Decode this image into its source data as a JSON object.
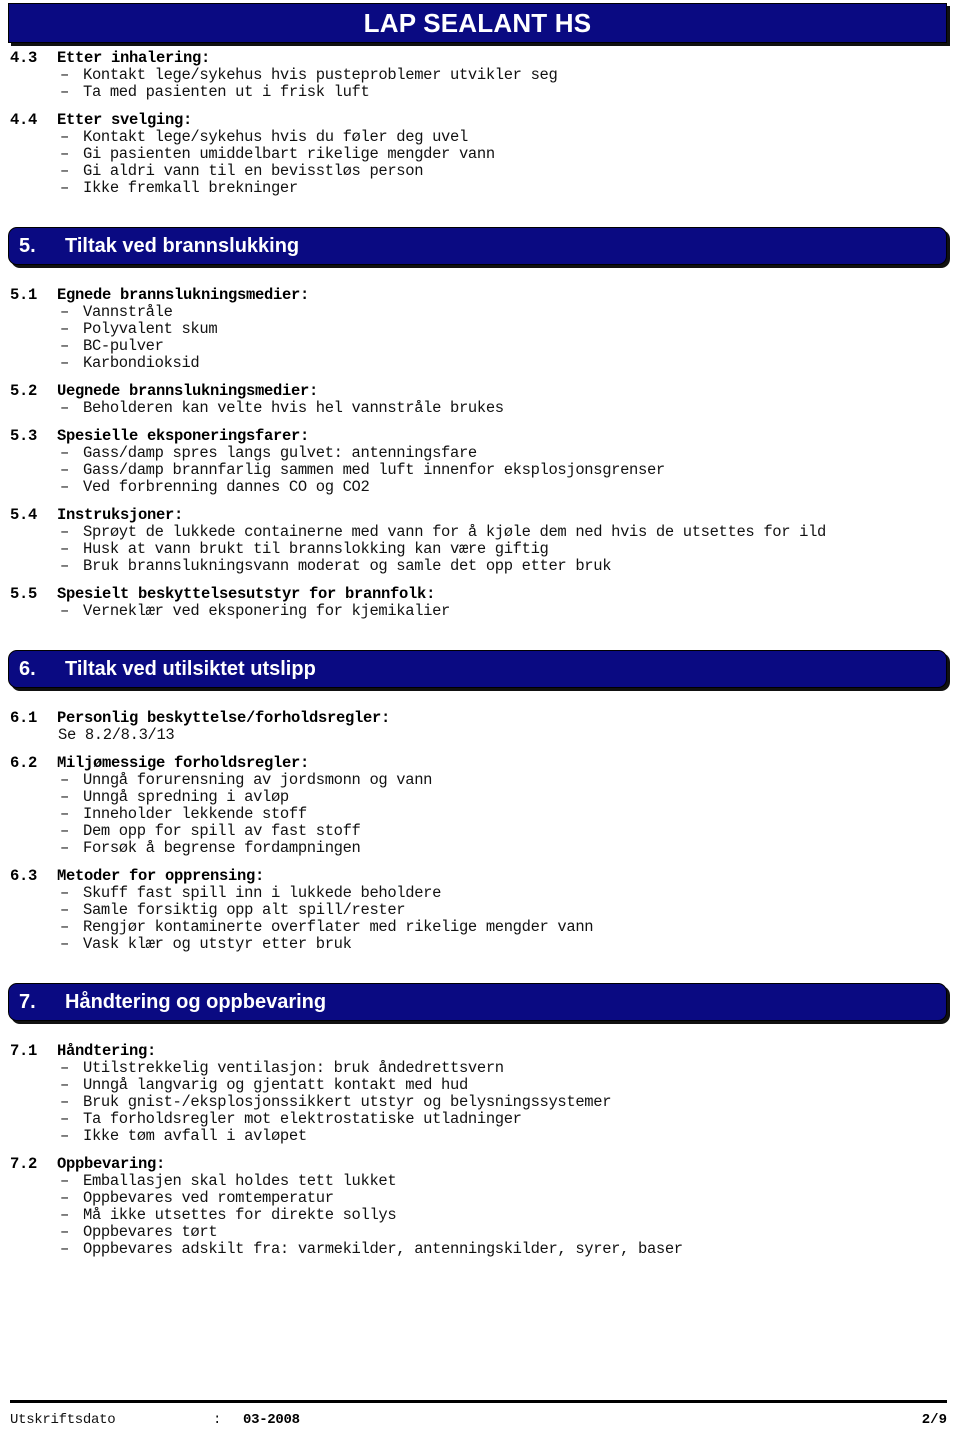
{
  "document": {
    "title": "LAP SEALANT HS",
    "banner_color": "#0a0a82",
    "banner_text_color": "#ffffff"
  },
  "blocks": [
    {
      "kind": "subsection",
      "number": "4.3",
      "title": "Etter inhalering:",
      "items": [
        "Kontakt lege/sykehus hvis pusteproblemer utvikler seg",
        "Ta med pasienten ut i frisk luft"
      ]
    },
    {
      "kind": "subsection",
      "number": "4.4",
      "title": "Etter svelging:",
      "items": [
        "Kontakt lege/sykehus hvis du føler deg uvel",
        "Gi pasienten umiddelbart rikelige mengder vann",
        "Gi aldri vann til en bevisstløs person",
        "Ikke fremkall brekninger"
      ]
    },
    {
      "kind": "banner",
      "number": "5.",
      "title": "Tiltak ved brannslukking"
    },
    {
      "kind": "subsection",
      "number": "5.1",
      "title": "Egnede brannslukningsmedier:",
      "items": [
        "Vannstråle",
        "Polyvalent skum",
        "BC-pulver",
        "Karbondioksid"
      ]
    },
    {
      "kind": "subsection",
      "number": "5.2",
      "title": "Uegnede brannslukningsmedier:",
      "items": [
        "Beholderen kan velte hvis hel vannstråle brukes"
      ]
    },
    {
      "kind": "subsection",
      "number": "5.3",
      "title": "Spesielle eksponeringsfarer:",
      "items": [
        "Gass/damp spres langs gulvet: antenningsfare",
        "Gass/damp brannfarlig sammen med luft innenfor eksplosjonsgrenser",
        "Ved forbrenning dannes CO og CO2"
      ]
    },
    {
      "kind": "subsection",
      "number": "5.4",
      "title": "Instruksjoner:",
      "items": [
        "Sprøyt de lukkede containerne med vann for å kjøle dem ned hvis de utsettes for ild",
        "Husk at vann brukt til brannslokking kan være giftig",
        "Bruk brannslukningsvann moderat og samle det opp etter bruk"
      ]
    },
    {
      "kind": "subsection",
      "number": "5.5",
      "title": "Spesielt beskyttelsesutstyr for brannfolk:",
      "items": [
        "Verneklær ved eksponering for kjemikalier"
      ]
    },
    {
      "kind": "banner",
      "number": "6.",
      "title": "Tiltak ved utilsiktet utslipp"
    },
    {
      "kind": "subsection",
      "number": "6.1",
      "title": "Personlig beskyttelse/forholdsregler:",
      "plain": [
        "Se 8.2/8.3/13"
      ],
      "items": []
    },
    {
      "kind": "subsection",
      "number": "6.2",
      "title": "Miljømessige forholdsregler:",
      "items": [
        "Unngå forurensning av jordsmonn og vann",
        "Unngå spredning i avløp",
        "Inneholder lekkende stoff",
        "Dem opp for spill av fast stoff",
        "Forsøk å begrense fordampningen"
      ]
    },
    {
      "kind": "subsection",
      "number": "6.3",
      "title": "Metoder for opprensing:",
      "items": [
        "Skuff fast spill inn i lukkede beholdere",
        "Samle forsiktig opp alt spill/rester",
        "Rengjør kontaminerte overflater med rikelige mengder vann",
        "Vask klær og utstyr etter bruk"
      ]
    },
    {
      "kind": "banner",
      "number": "7.",
      "title": "Håndtering og oppbevaring"
    },
    {
      "kind": "subsection",
      "number": "7.1",
      "title": "Håndtering:",
      "items": [
        "Utilstrekkelig ventilasjon: bruk åndedrettsvern",
        "Unngå langvarig og gjentatt kontakt med hud",
        "Bruk gnist-/eksplosjonssikkert utstyr og belysningssystemer",
        "Ta forholdsregler mot elektrostatiske utladninger",
        "Ikke tøm avfall i avløpet"
      ]
    },
    {
      "kind": "subsection",
      "number": "7.2",
      "title": "Oppbevaring:",
      "items": [
        "Emballasjen skal holdes tett lukket",
        "Oppbevares ved romtemperatur",
        "Må ikke utsettes for direkte sollys",
        "Oppbevares tørt",
        "Oppbevares adskilt fra: varmekilder, antenningskilder, syrer, baser"
      ]
    }
  ],
  "footer": {
    "label": "Utskriftsdato",
    "separator": ":",
    "date": "03-2008",
    "page": "2/9"
  }
}
